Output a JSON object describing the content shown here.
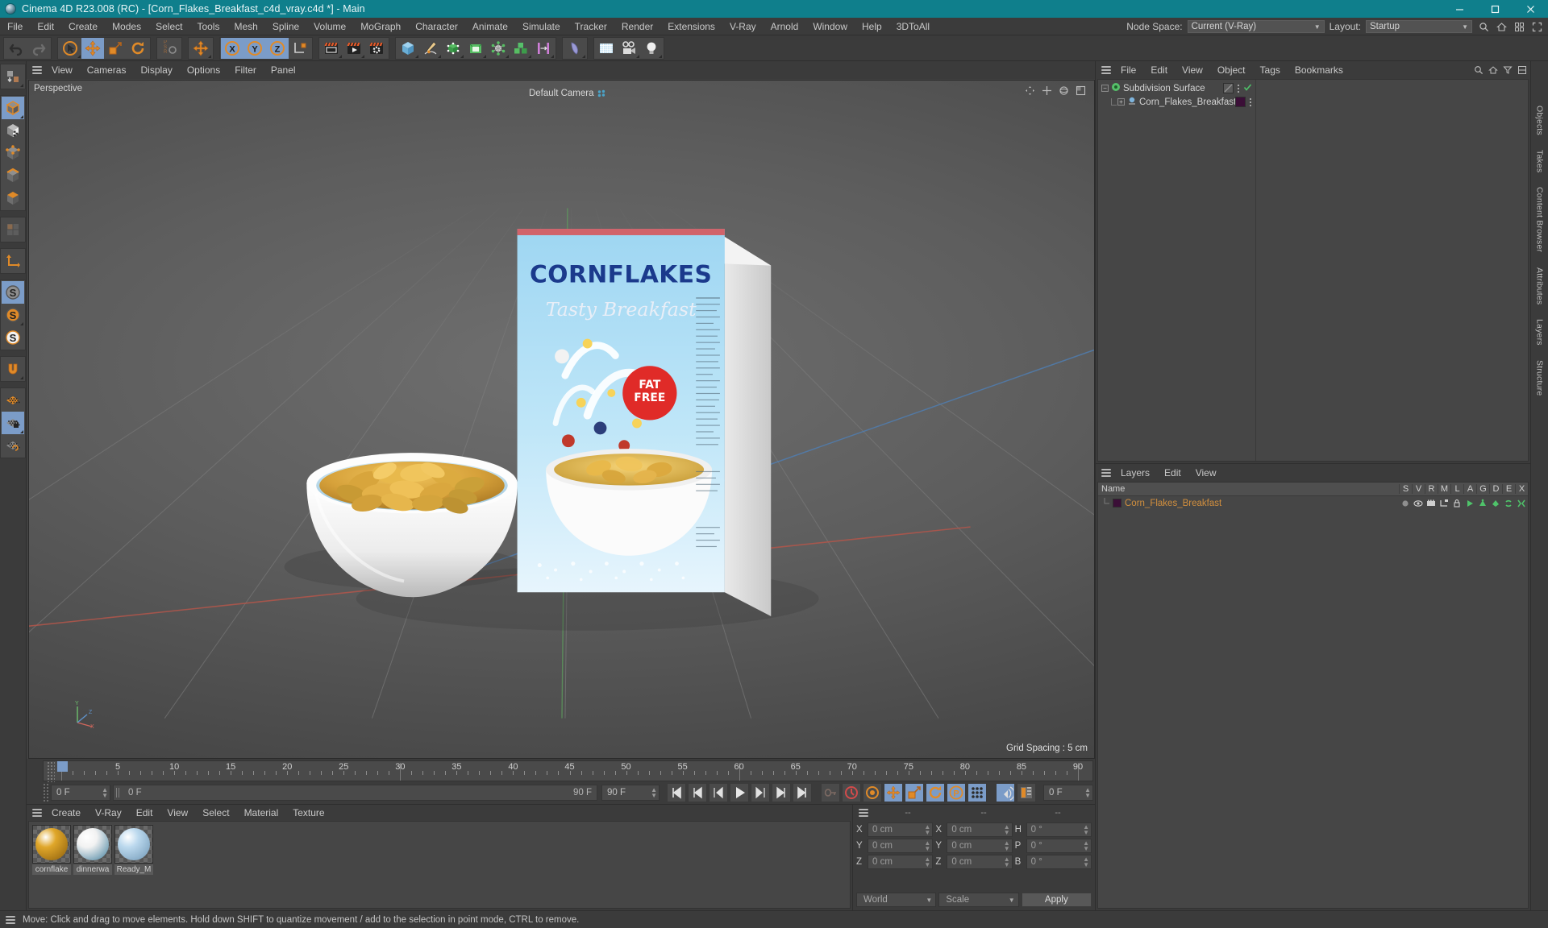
{
  "titlebar": {
    "app_title": "Cinema 4D R23.008 (RC) - [Corn_Flakes_Breakfast_c4d_vray.c4d *] - Main",
    "minimize": "–",
    "maximize": "❐",
    "close": "✕"
  },
  "menubar": {
    "items": [
      "File",
      "Edit",
      "Create",
      "Modes",
      "Select",
      "Tools",
      "Mesh",
      "Spline",
      "Volume",
      "MoGraph",
      "Character",
      "Animate",
      "Simulate",
      "Tracker",
      "Render",
      "Extensions",
      "V-Ray",
      "Arnold",
      "Window",
      "Help",
      "3DToAll"
    ],
    "node_space_label": "Node Space:",
    "node_space_value": "Current (V-Ray)",
    "layout_label": "Layout:",
    "layout_value": "Startup"
  },
  "toolbar": {
    "groups": [
      {
        "name": "history",
        "buttons": [
          {
            "name": "undo-button",
            "icon": "undo",
            "active": false,
            "corner": false
          },
          {
            "name": "redo-button",
            "icon": "redo",
            "active": false,
            "corner": false
          }
        ]
      },
      {
        "name": "transform-tools",
        "buttons": [
          {
            "name": "select-tool-button",
            "icon": "cursor-circle",
            "active": false,
            "corner": true
          },
          {
            "name": "move-tool-button",
            "icon": "move-arrows",
            "active": true,
            "corner": false
          },
          {
            "name": "scale-tool-button",
            "icon": "scale-box",
            "active": false,
            "corner": false
          },
          {
            "name": "rotate-tool-button",
            "icon": "rotate-arc",
            "active": false,
            "corner": false
          }
        ]
      },
      {
        "name": "psr-group",
        "buttons": [
          {
            "name": "psr-toggle-button",
            "icon": "psr",
            "active": false,
            "corner": false
          }
        ]
      },
      {
        "name": "axis-group",
        "buttons": [
          {
            "name": "world-axis-button",
            "icon": "move-arrows",
            "active": false,
            "corner": true
          }
        ]
      },
      {
        "name": "axis-locks",
        "buttons": [
          {
            "name": "lock-x-button",
            "icon": "letter-X",
            "active": true,
            "corner": false
          },
          {
            "name": "lock-y-button",
            "icon": "letter-Y",
            "active": true,
            "corner": false
          },
          {
            "name": "lock-z-button",
            "icon": "letter-Z",
            "active": true,
            "corner": false
          },
          {
            "name": "object-world-toggle-button",
            "icon": "axis-cube",
            "active": false,
            "corner": false
          }
        ]
      },
      {
        "name": "render-group",
        "buttons": [
          {
            "name": "render-view-button",
            "icon": "render-frame",
            "active": false,
            "corner": true
          },
          {
            "name": "render-to-picture-viewer-button",
            "icon": "render-play",
            "active": false,
            "corner": true
          },
          {
            "name": "render-settings-button",
            "icon": "render-gear",
            "active": false,
            "corner": false
          }
        ]
      },
      {
        "name": "create-group",
        "buttons": [
          {
            "name": "add-cube-button",
            "icon": "blue-cube",
            "active": false,
            "corner": true
          },
          {
            "name": "add-spline-button",
            "icon": "pen-spline",
            "active": false,
            "corner": true
          },
          {
            "name": "add-generator-button",
            "icon": "green-nurbs",
            "active": false,
            "corner": true
          },
          {
            "name": "add-deformer-button",
            "icon": "green-open-cube",
            "active": false,
            "corner": true
          },
          {
            "name": "add-scene-object-button",
            "icon": "gray-atom",
            "active": false,
            "corner": true
          },
          {
            "name": "add-mograph-button",
            "icon": "green-cubes",
            "active": false,
            "corner": true
          },
          {
            "name": "add-effector-button",
            "icon": "pink-bars",
            "active": false,
            "corner": true
          }
        ]
      },
      {
        "name": "deform-group",
        "buttons": [
          {
            "name": "add-bend-deformer-button",
            "icon": "bend-shape",
            "active": false,
            "corner": true
          }
        ]
      },
      {
        "name": "env-group",
        "buttons": [
          {
            "name": "add-floor-button",
            "icon": "floor-grid",
            "active": false,
            "corner": false
          },
          {
            "name": "add-camera-button",
            "icon": "camera",
            "active": false,
            "corner": true
          },
          {
            "name": "add-light-button",
            "icon": "light-bulb",
            "active": false,
            "corner": true
          }
        ]
      }
    ]
  },
  "leftbar": {
    "groups": [
      {
        "buttons": [
          {
            "name": "make-editable-button",
            "icon": "make-editable",
            "active": false,
            "corner": true
          }
        ]
      },
      {
        "buttons": [
          {
            "name": "model-mode-button",
            "icon": "model-cube",
            "active": true,
            "corner": true
          },
          {
            "name": "texture-mode-button",
            "icon": "texture-cube",
            "active": false,
            "corner": false
          },
          {
            "name": "point-mode-button",
            "icon": "point-cube",
            "active": false,
            "corner": false
          },
          {
            "name": "edge-mode-button",
            "icon": "edge-cube",
            "active": false,
            "corner": false
          },
          {
            "name": "polygon-mode-button",
            "icon": "poly-cube",
            "active": false,
            "corner": false
          }
        ]
      },
      {
        "buttons": [
          {
            "name": "uv-mode-button",
            "icon": "uv-grid",
            "active": false,
            "corner": false
          }
        ]
      },
      {
        "buttons": [
          {
            "name": "axis-mode-button",
            "icon": "axis-l",
            "active": false,
            "corner": false
          }
        ]
      },
      {
        "buttons": [
          {
            "name": "enable-axis-button",
            "icon": "s-gray",
            "active": true,
            "corner": false
          },
          {
            "name": "viewport-solo-button",
            "icon": "s-orange",
            "active": false,
            "corner": true
          },
          {
            "name": "viewport-solo-hierarchy-button",
            "icon": "s-white",
            "active": false,
            "corner": false
          }
        ]
      },
      {
        "buttons": [
          {
            "name": "snap-magnet-button",
            "icon": "magnet",
            "active": false,
            "corner": true
          }
        ]
      },
      {
        "buttons": [
          {
            "name": "workplane-button",
            "icon": "plane-orange",
            "active": false,
            "corner": false
          },
          {
            "name": "lock-workplane-button",
            "icon": "plane-lock",
            "active": true,
            "corner": true
          },
          {
            "name": "align-workplane-button",
            "icon": "plane-rotate",
            "active": false,
            "corner": false
          }
        ]
      }
    ]
  },
  "viewport": {
    "menu": [
      "View",
      "Cameras",
      "Display",
      "Options",
      "Filter",
      "Panel"
    ],
    "label": "Perspective",
    "camera_label": "Default Camera",
    "grid_spacing": "Grid Spacing : 5 cm",
    "axis_x": "X",
    "axis_y": "Y",
    "axis_z": "Z",
    "scene": {
      "box_brand": "CORNFLAKES",
      "box_tagline": "Tasty Breakfast",
      "box_badge_line1": "FAT",
      "box_badge_line2": "FREE"
    }
  },
  "timeline": {
    "start_label": "0 F",
    "current_frame_field": "0 F",
    "preview_start": "0 F",
    "preview_end": "90 F",
    "end_field": "90 F",
    "doc_end_field": "90 F",
    "right_frame_field": "0 F",
    "ticks": [
      {
        "v": 0,
        "label": "0"
      },
      {
        "v": 5,
        "label": "5"
      },
      {
        "v": 10,
        "label": "10"
      },
      {
        "v": 15,
        "label": "15"
      },
      {
        "v": 20,
        "label": "20"
      },
      {
        "v": 25,
        "label": "25"
      },
      {
        "v": 30,
        "label": "30"
      },
      {
        "v": 35,
        "label": "35"
      },
      {
        "v": 40,
        "label": "40"
      },
      {
        "v": 45,
        "label": "45"
      },
      {
        "v": 50,
        "label": "50"
      },
      {
        "v": 55,
        "label": "55"
      },
      {
        "v": 60,
        "label": "60"
      },
      {
        "v": 65,
        "label": "65"
      },
      {
        "v": 70,
        "label": "70"
      },
      {
        "v": 75,
        "label": "75"
      },
      {
        "v": 80,
        "label": "80"
      },
      {
        "v": 85,
        "label": "85"
      },
      {
        "v": 90,
        "label": "90"
      }
    ],
    "transport": [
      {
        "name": "go-to-start-button",
        "icon": "skip-start"
      },
      {
        "name": "go-to-previous-key-button",
        "icon": "prev-key"
      },
      {
        "name": "step-back-button",
        "icon": "step-back"
      },
      {
        "name": "play-button",
        "icon": "play"
      },
      {
        "name": "step-forward-button",
        "icon": "step-fwd"
      },
      {
        "name": "go-to-next-key-button",
        "icon": "next-key"
      },
      {
        "name": "go-to-end-button",
        "icon": "skip-end"
      }
    ],
    "record_tools": [
      {
        "name": "record-key-button",
        "icon": "key-disabled",
        "active": false
      },
      {
        "name": "autokey-button",
        "icon": "record-circle",
        "active": false
      },
      {
        "name": "keyframe-settings-button",
        "icon": "gear-circle",
        "active": false
      },
      {
        "name": "key-position-button",
        "icon": "move-key",
        "active": true
      },
      {
        "name": "key-scale-button",
        "icon": "scale-key",
        "active": true
      },
      {
        "name": "key-rotation-button",
        "icon": "rotate-key",
        "active": true
      },
      {
        "name": "key-parameter-button",
        "icon": "param-key",
        "active": true
      },
      {
        "name": "key-point-level-button",
        "icon": "pla-key",
        "active": true
      }
    ],
    "right_tools": [
      {
        "name": "sound-toggle-button",
        "icon": "speaker",
        "active": true
      },
      {
        "name": "timeline-layout-button",
        "icon": "timeline-grid",
        "active": false
      }
    ]
  },
  "material_manager": {
    "menu": [
      "Create",
      "V-Ray",
      "Edit",
      "View",
      "Select",
      "Material",
      "Texture"
    ],
    "materials": [
      {
        "name": "cornflake",
        "color_a": "#e0a72a",
        "color_b": "#8a5d0c"
      },
      {
        "name": "dinnerwa",
        "color_a": "#f2f2f2",
        "color_b": "#3f7d9c"
      },
      {
        "name": "Ready_M",
        "color_a": "#bcd9ee",
        "color_b": "#6f97b5"
      }
    ]
  },
  "coordinates": {
    "header": [
      "--",
      "--",
      "--"
    ],
    "rows": [
      {
        "pos_label": "X",
        "pos_value": "0 cm",
        "size_label": "X",
        "size_value": "0 cm",
        "rot_label": "H",
        "rot_value": "0 °"
      },
      {
        "pos_label": "Y",
        "pos_value": "0 cm",
        "size_label": "Y",
        "size_value": "0 cm",
        "rot_label": "P",
        "rot_value": "0 °"
      },
      {
        "pos_label": "Z",
        "pos_value": "0 cm",
        "size_label": "Z",
        "size_value": "0 cm",
        "rot_label": "B",
        "rot_value": "0 °"
      }
    ],
    "system_value": "World",
    "mode_value": "Scale",
    "apply_label": "Apply"
  },
  "object_manager": {
    "menu": [
      "File",
      "Edit",
      "View",
      "Object",
      "Tags",
      "Bookmarks"
    ],
    "rows": [
      {
        "name": "Subdivision Surface",
        "depth": 0,
        "color": "#56c06a",
        "swatch": "#5a5a5a",
        "check": true
      },
      {
        "name": "Corn_Flakes_Breakfast",
        "depth": 1,
        "color": "#7eb4dc",
        "swatch": "#3b0f37",
        "check": false
      }
    ]
  },
  "layers": {
    "menu": [
      "Layers",
      "Edit",
      "View"
    ],
    "name_header": "Name",
    "columns": [
      "S",
      "V",
      "R",
      "M",
      "L",
      "A",
      "G",
      "D",
      "E",
      "X"
    ],
    "rows": [
      {
        "name": "Corn_Flakes_Breakfast",
        "swatch": "#3b0f37"
      }
    ]
  },
  "right_rail": {
    "tabs": [
      "Objects",
      "Takes",
      "Content Browser",
      "Attributes",
      "Layers",
      "Structure"
    ]
  },
  "statusbar": {
    "message": "Move: Click and drag to move elements. Hold down SHIFT to quantize movement / add to the selection in point mode, CTRL to remove."
  }
}
